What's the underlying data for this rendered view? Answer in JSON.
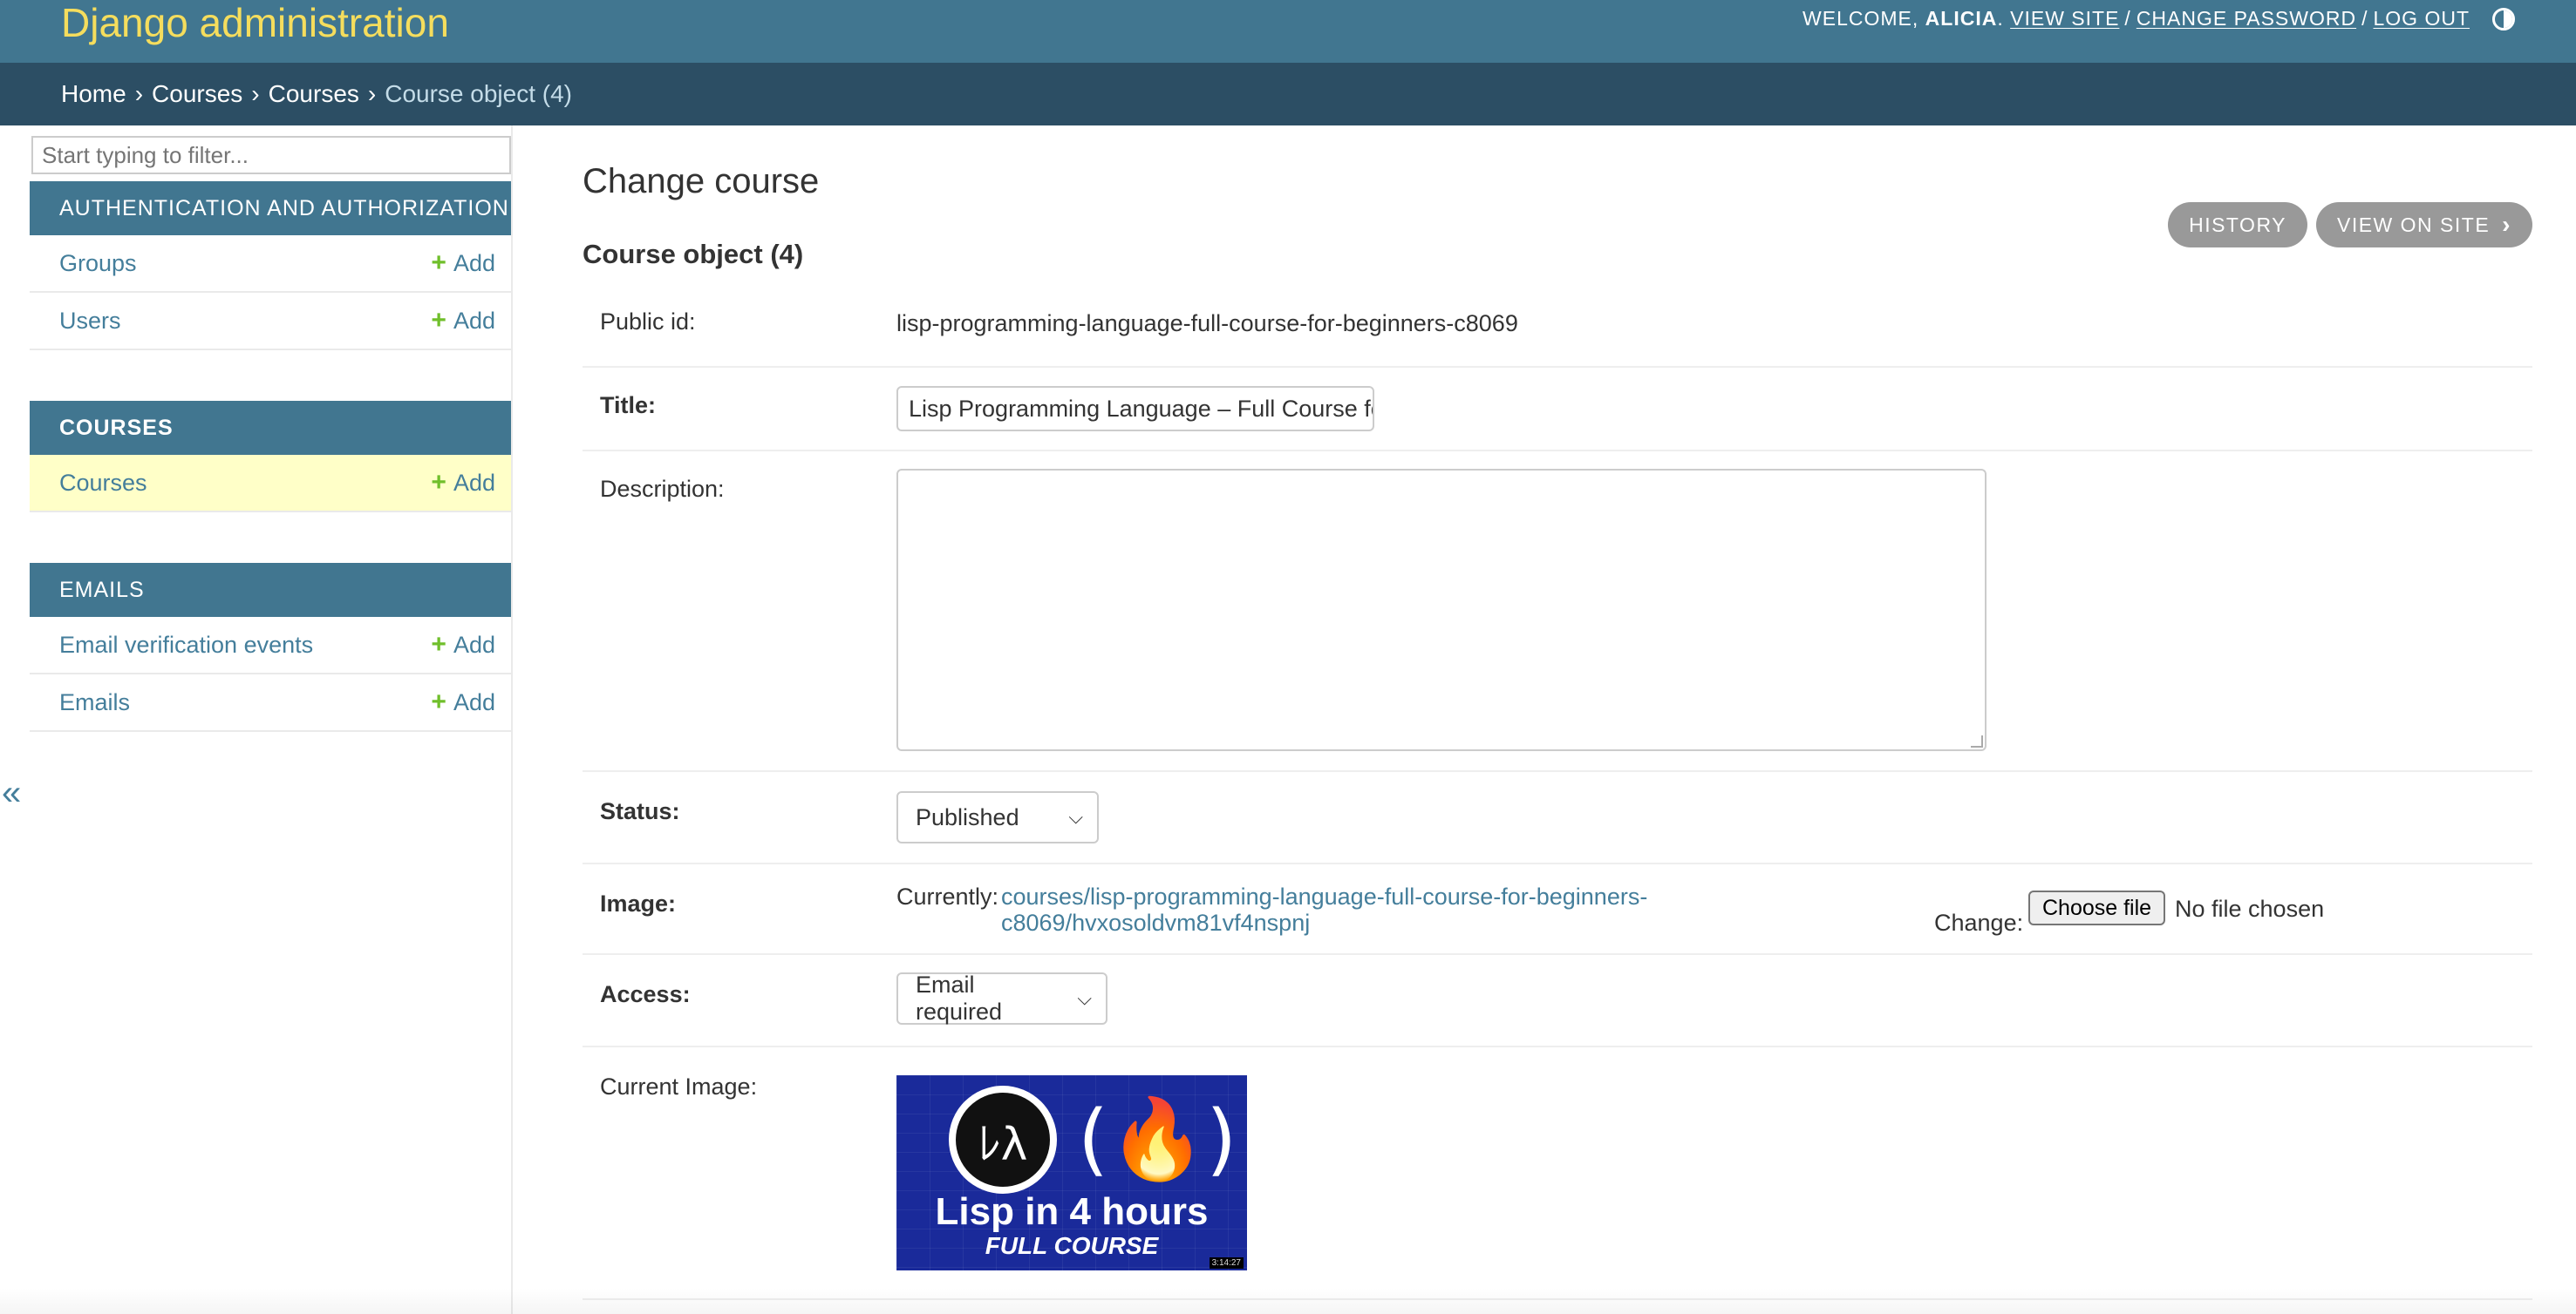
{
  "header": {
    "branding": "Django administration",
    "welcome": "WELCOME,",
    "username": "ALICIA",
    "view_site": "VIEW SITE",
    "change_password": "CHANGE PASSWORD",
    "log_out": "LOG OUT",
    "theme_icon": "theme-toggle-icon"
  },
  "breadcrumbs": {
    "home": "Home",
    "app": "Courses",
    "model": "Courses",
    "current": "Course object (4)",
    "separator": "›"
  },
  "sidebar": {
    "filter_placeholder": "Start typing to filter...",
    "modules": [
      {
        "caption": "AUTHENTICATION AND AUTHORIZATION",
        "models": [
          {
            "name": "Groups",
            "add": "Add"
          },
          {
            "name": "Users",
            "add": "Add"
          }
        ]
      },
      {
        "caption": "COURSES",
        "models": [
          {
            "name": "Courses",
            "add": "Add"
          }
        ]
      },
      {
        "caption": "EMAILS",
        "models": [
          {
            "name": "Email verification events",
            "add": "Add"
          },
          {
            "name": "Emails",
            "add": "Add"
          }
        ]
      }
    ],
    "collapse_toggle": "«"
  },
  "content": {
    "title": "Change course",
    "object_heading": "Course object (4)",
    "tools": {
      "history": "HISTORY",
      "view_on_site": "VIEW ON SITE"
    },
    "fields": {
      "public_id": {
        "label": "Public id:",
        "value": "lisp-programming-language-full-course-for-beginners-c8069"
      },
      "title": {
        "label": "Title:",
        "value": "Lisp Programming Language – Full Course for Beginners"
      },
      "description": {
        "label": "Description:",
        "value": ""
      },
      "status": {
        "label": "Status:",
        "value": "Published"
      },
      "image": {
        "label": "Image:",
        "currently": "Currently:",
        "link_line1": "courses/lisp-programming-language-full-course-for-beginners-",
        "link_line2": "c8069/hvxosoldvm81vf4nspnj",
        "change": "Change:",
        "choose_file": "Choose file",
        "no_file": "No file chosen"
      },
      "access": {
        "label": "Access:",
        "value": "Email required"
      },
      "current_image": {
        "label": "Current Image:",
        "thumb_line1": "Lisp in 4 hours",
        "thumb_line2": "FULL COURSE",
        "thumb_duration": "3:14:27"
      }
    }
  }
}
